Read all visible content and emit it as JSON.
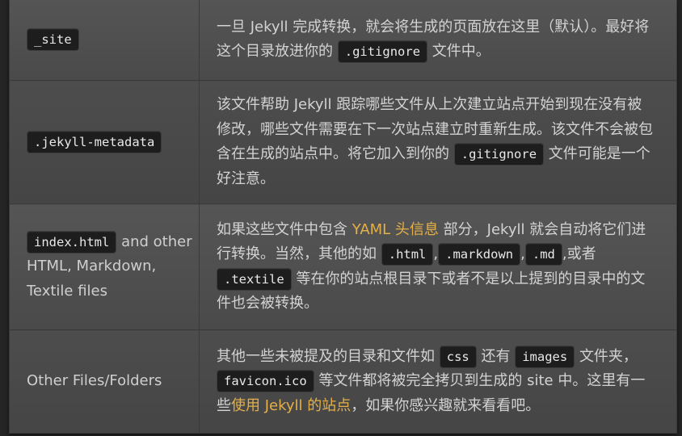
{
  "rows": [
    {
      "name_code": "_site",
      "desc": {
        "t1": "一旦 Jekyll 完成转换，就会将生成的页面放在这里（默认）。最好将这个目录放进你的",
        "c1": ".gitignore",
        "t2": "文件中。"
      }
    },
    {
      "name_code": ".jekyll-metadata",
      "desc": {
        "t1": "该文件帮助 Jekyll 跟踪哪些文件从上次建立站点开始到现在没有被修改，哪些文件需要在下一次站点建立时重新生成。该文件不会被包含在生成的站点中。将它加入到你的",
        "c1": ".gitignore",
        "t2": "文件可能是一个好注意。"
      }
    },
    {
      "name_code": "index.html",
      "name_text": "and other HTML, Markdown, Textile files",
      "desc": {
        "t1": "如果这些文件中包含",
        "link": "YAML 头信息",
        "t2": "部分，Jekyll 就会自动将它们进行转换。当然，其他的如",
        "c1": ".html",
        "s1": ",",
        "c2": ".markdown",
        "s2": ",",
        "c3": ".md",
        "t3": ",或者",
        "c4": ".textile",
        "t4": "等在你的站点根目录下或者不是以上提到的目录中的文件也会被转换。"
      }
    },
    {
      "name_text": "Other Files/Folders",
      "desc": {
        "t1": "其他一些未被提及的目录和文件如",
        "c1": "css",
        "t2": "还有",
        "c2": "images",
        "t3": "文件夹，",
        "c3": "favicon.ico",
        "t4": "等文件都将被完全拷贝到生成的 site 中。这里有一些",
        "link": "使用 Jekyll 的站点",
        "t5": "，如果你感兴趣就来看看吧。"
      }
    }
  ],
  "colors": {
    "link": "#e3b04a",
    "text": "#d3d3d3",
    "code_bg": "#1d1d1d"
  }
}
